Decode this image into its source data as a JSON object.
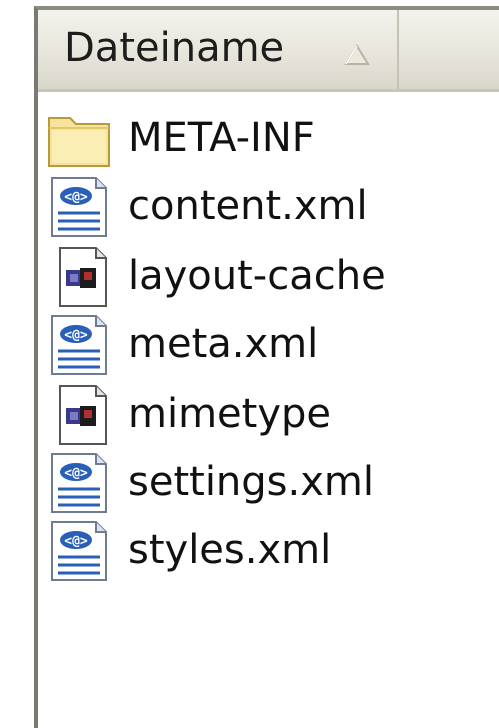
{
  "header": {
    "column_label": "Dateiname",
    "sort_icon": "sort-ascending-triangle-icon"
  },
  "files": [
    {
      "name": "META-INF",
      "icon": "folder-icon"
    },
    {
      "name": "content.xml",
      "icon": "xml-file-icon"
    },
    {
      "name": "layout-cache",
      "icon": "system-file-icon"
    },
    {
      "name": "meta.xml",
      "icon": "xml-file-icon"
    },
    {
      "name": "mimetype",
      "icon": "system-file-icon"
    },
    {
      "name": "settings.xml",
      "icon": "xml-file-icon"
    },
    {
      "name": "styles.xml",
      "icon": "xml-file-icon"
    }
  ],
  "colors": {
    "folder": "#f6e49c",
    "xml_icon_blue": "#2a5fb8",
    "text": "#111111"
  }
}
